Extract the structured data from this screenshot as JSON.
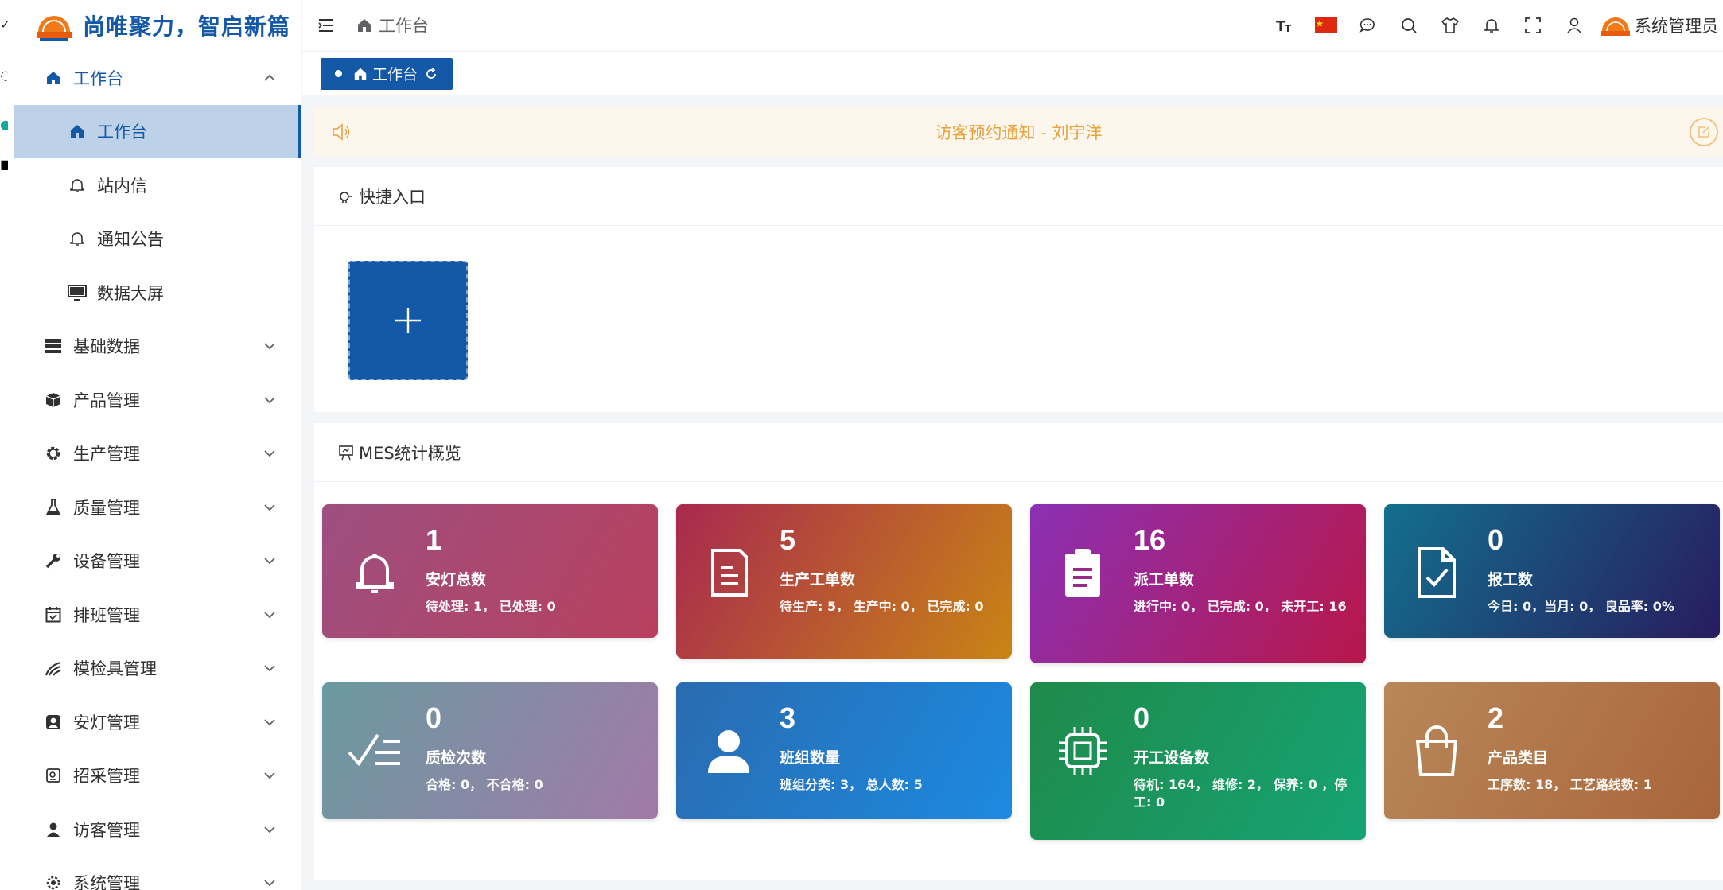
{
  "brand": {
    "title": "尚唯聚力，智启新篇"
  },
  "sidebar": {
    "workbench_group": "工作台",
    "sub_items": [
      {
        "label": "工作台",
        "icon": "home-icon"
      },
      {
        "label": "站内信",
        "icon": "bell-icon"
      },
      {
        "label": "通知公告",
        "icon": "bell-icon"
      },
      {
        "label": "数据大屏",
        "icon": "monitor-icon"
      }
    ],
    "groups": [
      {
        "label": "基础数据",
        "icon": "database-icon"
      },
      {
        "label": "产品管理",
        "icon": "cube-icon"
      },
      {
        "label": "生产管理",
        "icon": "gear-icon"
      },
      {
        "label": "质量管理",
        "icon": "flask-icon"
      },
      {
        "label": "设备管理",
        "icon": "wrench-icon"
      },
      {
        "label": "排班管理",
        "icon": "calendar-icon"
      },
      {
        "label": "模检具管理",
        "icon": "tool-icon"
      },
      {
        "label": "安灯管理",
        "icon": "andon-icon"
      },
      {
        "label": "招采管理",
        "icon": "procure-icon"
      },
      {
        "label": "访客管理",
        "icon": "user-icon"
      },
      {
        "label": "系统管理",
        "icon": "settings-icon"
      }
    ]
  },
  "topbar": {
    "breadcrumb": "工作台",
    "user_name": "系统管理员"
  },
  "tags": {
    "active": "工作台"
  },
  "notice": {
    "text": "访客预约通知 - 刘宇洋"
  },
  "quick": {
    "title": "快捷入口"
  },
  "stats": {
    "title": "MES统计概览",
    "cards": [
      {
        "value": "1",
        "label": "安灯总数",
        "sub": "待处理: 1， 已处理: 0",
        "icon": "bell-icon",
        "from": "#9d4f80",
        "to": "#b8405e"
      },
      {
        "value": "5",
        "label": "生产工单数",
        "sub": "待生产: 5， 生产中: 0， 已完成: 0",
        "icon": "document-icon",
        "from": "#a8294f",
        "to": "#c98514"
      },
      {
        "value": "16",
        "label": "派工单数",
        "sub": "进行中: 0， 已完成: 0， 未开工: 16",
        "icon": "clipboard-icon",
        "from": "#8b30b4",
        "to": "#b8174a"
      },
      {
        "value": "0",
        "label": "报工数",
        "sub": "今日: 0，当月: 0， 良品率: 0%",
        "icon": "file-check-icon",
        "from": "#136f8e",
        "to": "#281c5e"
      },
      {
        "value": "0",
        "label": "质检次数",
        "sub": "合格: 0， 不合格: 0",
        "icon": "check-list-icon",
        "from": "#6a9aa0",
        "to": "#a27aa8"
      },
      {
        "value": "3",
        "label": "班组数量",
        "sub": "班组分类: 3， 总人数: 5",
        "icon": "user-icon",
        "from": "#2a6bb0",
        "to": "#1c8ae0"
      },
      {
        "value": "0",
        "label": "开工设备数",
        "sub": "待机: 164， 维修: 2， 保养: 0 ，停工: 0",
        "icon": "chip-icon",
        "from": "#1f8a4a",
        "to": "#16a374"
      },
      {
        "value": "2",
        "label": "产品类目",
        "sub": "工序数: 18， 工艺路线数: 1",
        "icon": "bag-icon",
        "from": "#b88758",
        "to": "#a9653a"
      }
    ]
  }
}
